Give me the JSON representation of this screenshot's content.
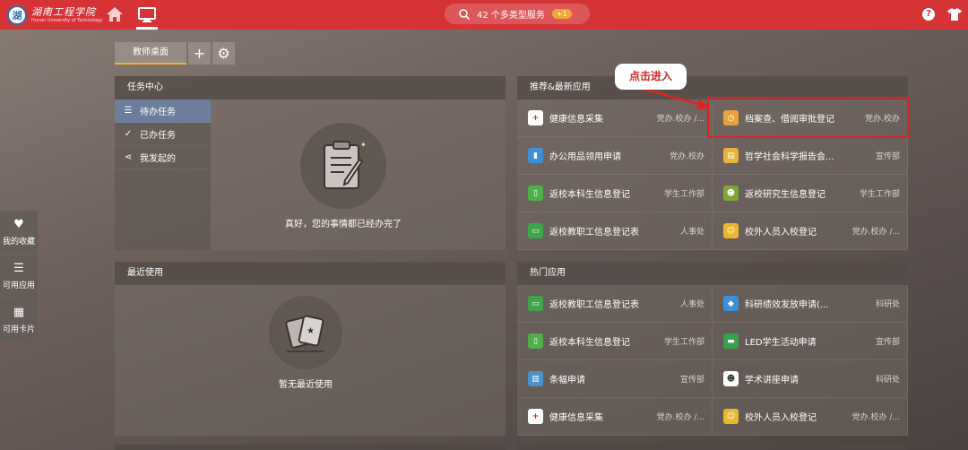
{
  "topbar": {
    "logo_text": "湖南工程学院",
    "logo_en": "Hunan University of Technology",
    "search_text": "42 个多类型服务",
    "search_badge": "+1",
    "help": "?"
  },
  "tabs": {
    "active_label": "教师桌面",
    "add_label": "+",
    "settings_label": "⚙"
  },
  "task_center": {
    "title": "任务中心",
    "items": [
      {
        "icon": "☰",
        "label": "待办任务"
      },
      {
        "icon": "✓",
        "label": "已办任务"
      },
      {
        "icon": "⋖",
        "label": "我发起的"
      }
    ],
    "empty_text": "真好，您的事情都已经办完了"
  },
  "recent": {
    "title": "最近使用",
    "empty_text": "暂无最近使用"
  },
  "recommended": {
    "title": "推荐&最新应用",
    "apps": [
      {
        "name": "健康信息采集",
        "dept": "党办.校办 /...",
        "icon": "+",
        "color": "#ffffff",
        "fg": "#d52525"
      },
      {
        "name": "档案查、借阅审批登记",
        "dept": "党办.校办",
        "icon": "◷",
        "color": "#e9a23b",
        "fg": "#ffffff"
      },
      {
        "name": "办公用品领用申请",
        "dept": "党办.校办",
        "icon": "▮",
        "color": "#3d8fd8",
        "fg": "#ffffff"
      },
      {
        "name": "哲学社会科学报告会...",
        "dept": "宣传部",
        "icon": "▤",
        "color": "#e8b33a",
        "fg": "#ffffff"
      },
      {
        "name": "返校本科生信息登记",
        "dept": "学生工作部",
        "icon": "▯",
        "color": "#4fb04a",
        "fg": "#ffffff"
      },
      {
        "name": "返校研究生信息登记",
        "dept": "学生工作部",
        "icon": "☻",
        "color": "#7fa63c",
        "fg": "#ffffff"
      },
      {
        "name": "返校教职工信息登记表",
        "dept": "人事处",
        "icon": "▭",
        "color": "#3fa54b",
        "fg": "#ffffff"
      },
      {
        "name": "校外人员入校登记",
        "dept": "党办.校办 /...",
        "icon": "☺",
        "color": "#e9b730",
        "fg": "#ffffff"
      }
    ]
  },
  "hot": {
    "title": "热门应用",
    "apps": [
      {
        "name": "返校教职工信息登记表",
        "dept": "人事处",
        "icon": "▭",
        "color": "#3fa54b",
        "fg": "#ffffff"
      },
      {
        "name": "科研绩效发放申请(...",
        "dept": "科研处",
        "icon": "◆",
        "color": "#3d8fd8",
        "fg": "#ffffff"
      },
      {
        "name": "返校本科生信息登记",
        "dept": "学生工作部",
        "icon": "▯",
        "color": "#4fb04a",
        "fg": "#ffffff"
      },
      {
        "name": "LED学生活动申请",
        "dept": "宣传部",
        "icon": "▬",
        "color": "#3aa14b",
        "fg": "#ffffff"
      },
      {
        "name": "条幅申请",
        "dept": "宣传部",
        "icon": "▥",
        "color": "#4a90c9",
        "fg": "#ffffff"
      },
      {
        "name": "学术讲座申请",
        "dept": "科研处",
        "icon": "☻",
        "color": "#ffffff",
        "fg": "#333333"
      },
      {
        "name": "健康信息采集",
        "dept": "党办.校办 /...",
        "icon": "+",
        "color": "#ffffff",
        "fg": "#d52525"
      },
      {
        "name": "校外人员入校登记",
        "dept": "党办.校办 /...",
        "icon": "☺",
        "color": "#e9b730",
        "fg": "#ffffff"
      }
    ]
  },
  "annotation": {
    "callout": "点击进入"
  },
  "side_widget": {
    "items": [
      {
        "icon": "♥",
        "label": "我的收藏"
      },
      {
        "icon": "☰",
        "label": "可用应用"
      },
      {
        "icon": "▦",
        "label": "可用卡片"
      }
    ]
  },
  "colors": {
    "topbar": "#d63336",
    "highlight": "#e02121",
    "tab_accent": "#f2b233",
    "active_menu": "#6e82aa"
  }
}
